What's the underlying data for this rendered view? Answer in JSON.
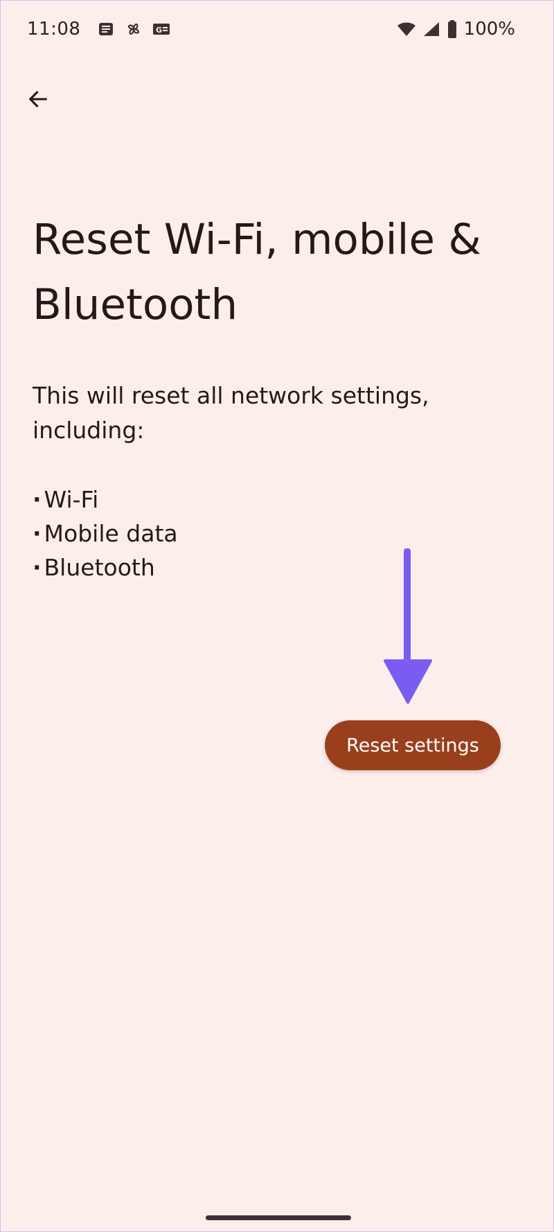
{
  "status_bar": {
    "time": "11:08",
    "notification_icons": [
      "news-icon",
      "pinwheel-icon",
      "gmail-icon"
    ],
    "system_icons": [
      "wifi-icon",
      "cellular-signal-icon",
      "battery-icon"
    ],
    "battery": "100%"
  },
  "page": {
    "title": "Reset Wi-Fi, mobile & Bluetooth",
    "description": "This will reset all network settings, including:",
    "items": [
      "Wi-Fi",
      "Mobile data",
      "Bluetooth"
    ]
  },
  "action": {
    "reset_label": "Reset settings"
  },
  "colors": {
    "background": "#FCEEEB",
    "button": "#9A3F1C",
    "annotation_arrow": "#7B5CF2"
  }
}
